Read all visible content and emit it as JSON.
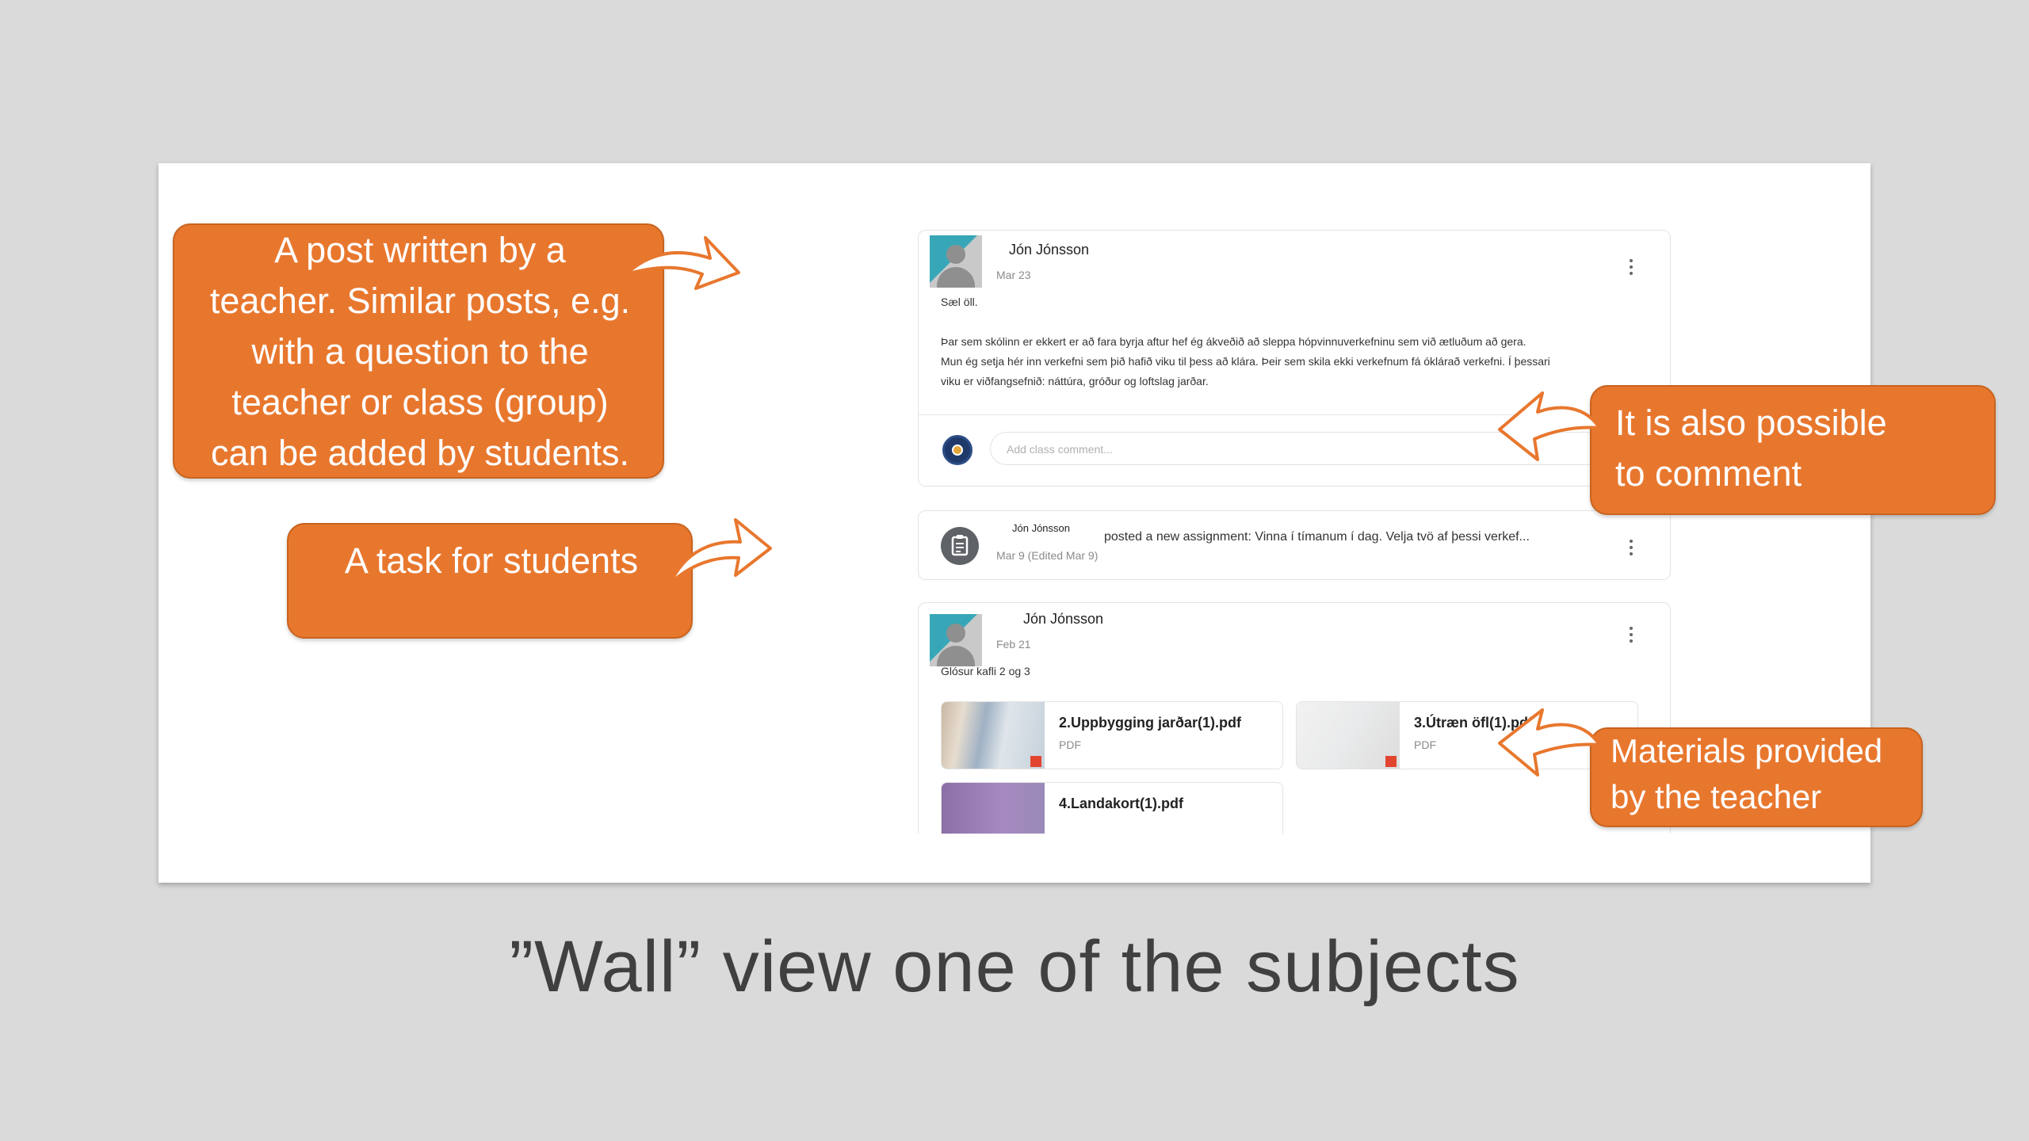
{
  "posts": {
    "teacher_post": {
      "author": "Jón Jónsson",
      "date": "Mar 23",
      "greeting": "Sæl öll.",
      "body_lines": [
        "Þar sem skólinn er ekkert er að fara byrja aftur hef ég ákveðið að sleppa hópvinnuverkefninu sem við ætluðum að gera.",
        "Mun ég setja hér inn verkefni sem þið hafið viku til þess að klára. Þeir sem skila ekki verkefnum fá óklárað verkefni. Í þessari",
        "viku er viðfangsefnið: náttúra, gróður og loftslag jarðar."
      ],
      "comment_placeholder": "Add class comment..."
    },
    "assignment_post": {
      "author": "Jón Jónsson",
      "text": "posted a new assignment: Vinna í tímanum í dag. Velja tvö af þessi verkef...",
      "date": "Mar 9 (Edited Mar 9)"
    },
    "materials_post": {
      "author": "Jón Jónsson",
      "date": "Feb 21",
      "title": "Glósur kafli 2 og 3",
      "attachments": [
        {
          "name": "2.Uppbygging jarðar(1).pdf",
          "type": "PDF"
        },
        {
          "name": "3.Útræn öfl(1).pdf",
          "type": "PDF"
        },
        {
          "name": "4.Landakort(1).pdf",
          "type": ""
        }
      ]
    }
  },
  "callouts": {
    "post": [
      "A post written by a",
      "teacher. Similar  posts, e.g.",
      "with a question to the",
      "teacher or class (group)",
      "can be added  by students."
    ],
    "task": [
      "A task for students"
    ],
    "comment": [
      "It is also possible",
      "to comment"
    ],
    "materials": [
      "Materials provided",
      "by the  teacher"
    ]
  },
  "slide_title": "”Wall” view one of the subjects",
  "colors": {
    "callout": "#e8772e",
    "background": "#dadada",
    "card": "#ffffff"
  }
}
